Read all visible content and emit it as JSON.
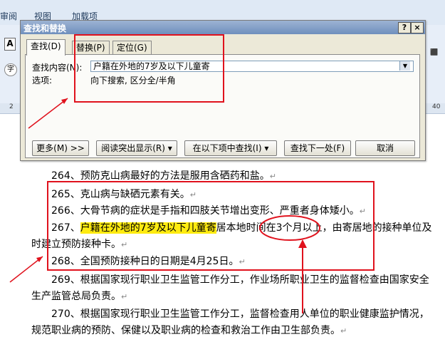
{
  "ribbon": {
    "tabs": [
      "审阅",
      "视图",
      "加载项"
    ],
    "ruler_marks": [
      "2",
      "40"
    ]
  },
  "dialog": {
    "title": "查找和替换",
    "help_icon": "?",
    "close_icon": "×",
    "tabs": [
      "查找(D)",
      "替换(P)",
      "定位(G)"
    ],
    "find_label": "查找内容(N):",
    "find_value": "户籍在外地的7岁及以下儿童寄",
    "options_label": "选项:",
    "options_value": "向下搜索, 区分全/半角",
    "buttons": {
      "more": "更多(M) >>",
      "highlight": "阅读突出显示(R) ▾",
      "find_in": "在以下项中查找(I) ▾",
      "find_next": "查找下一处(F)",
      "cancel": "取消"
    }
  },
  "document": {
    "lines": [
      {
        "text": "264、预防克山病最好的方法是服用含硒药和盐。"
      },
      {
        "text": "265、克山病与缺硒元素有关。"
      },
      {
        "text": "266、大骨节病的症状是手指和四肢关节增出变形、严重者身体矮小。"
      },
      {
        "highlight": "户籍在外地的7岁及以下儿童寄",
        "prefix": "267、",
        "rest": "居本地时间在3个月以上，由寄居地的接种单位及"
      },
      {
        "text": "时建立预防接种卡。"
      },
      {
        "text": "268、全国预防接种日的日期是4月25日。"
      },
      {
        "text": "269、根据国家现行职业卫生监管工作分工，作业场所职业卫生的监督检查由国家安全"
      },
      {
        "text": "生产监管总局负责。"
      },
      {
        "text": "270、根据国家现行职业卫生监管工作分工，监督检查用人单位的职业健康监护情况，"
      },
      {
        "text": "规范职业病的预防、保健以及职业病的检查和救治工作由卫生部负责。"
      }
    ],
    "paragraph_mark": "↵"
  },
  "colors": {
    "annotation": "#e0121d",
    "highlight": "#ffeb10",
    "dialog_bg": "#ece9d8"
  }
}
